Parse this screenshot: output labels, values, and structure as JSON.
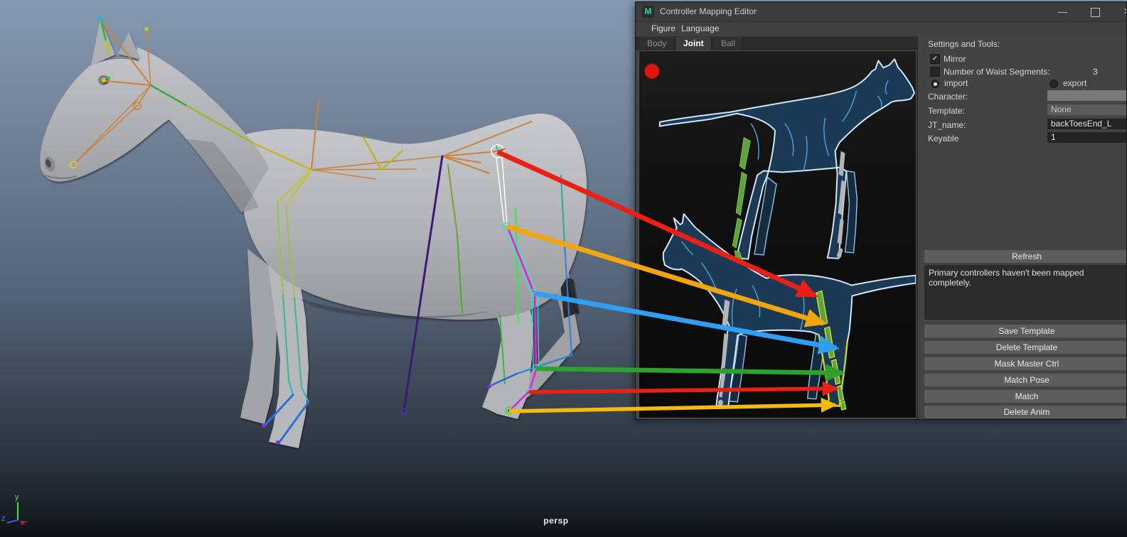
{
  "window": {
    "title": "Controller Mapping Editor",
    "icon_letter": "M",
    "close_glyph": "✕"
  },
  "menu": {
    "items": [
      "Figure",
      "Language"
    ]
  },
  "tabs": {
    "items": [
      {
        "label": "Body",
        "active": false
      },
      {
        "label": "Joint",
        "active": true
      },
      {
        "label": "Ball",
        "active": false
      }
    ]
  },
  "panel": {
    "heading": "Settings and Tools:",
    "check_glyph": "✓",
    "mirror_label": "Mirror",
    "mirror_checked": true,
    "waist_label": "Number of Waist Segments:",
    "waist_checked": false,
    "waist_value": "3",
    "import_label": "import",
    "import_selected": true,
    "export_label": "export",
    "export_selected": false,
    "character_label": "Character:",
    "character_value": "",
    "template_label": "Template:",
    "template_value": "None",
    "jt_name_label": "JT_name:",
    "jt_name_value": "backToesEnd_L",
    "keyable_label": "Keyable",
    "keyable_value": "1",
    "refresh_label": "Refresh",
    "message": "Primary controllers haven't been mapped completely.",
    "buttons": [
      "Save Template",
      "Delete Template",
      "Mask Master Ctrl",
      "Match Pose",
      "Match",
      "Delete Anim"
    ]
  },
  "viewport": {
    "camera_label": "persp",
    "axis_y": "y",
    "axis_z": "z",
    "axis_x": "x"
  },
  "mapping": {
    "record_color": "#e01212",
    "arrows": [
      {
        "name": "hip-mapping-arrow",
        "color": "#e82015"
      },
      {
        "name": "knee-mapping-arrow",
        "color": "#f2a50c"
      },
      {
        "name": "hock-mapping-arrow",
        "color": "#2e9ff2"
      },
      {
        "name": "fetlock-mapping-arrow",
        "color": "#2da32d"
      },
      {
        "name": "pastern-mapping-arrow",
        "color": "#e82015"
      },
      {
        "name": "toe-mapping-arrow",
        "color": "#f4bb0c"
      }
    ]
  }
}
